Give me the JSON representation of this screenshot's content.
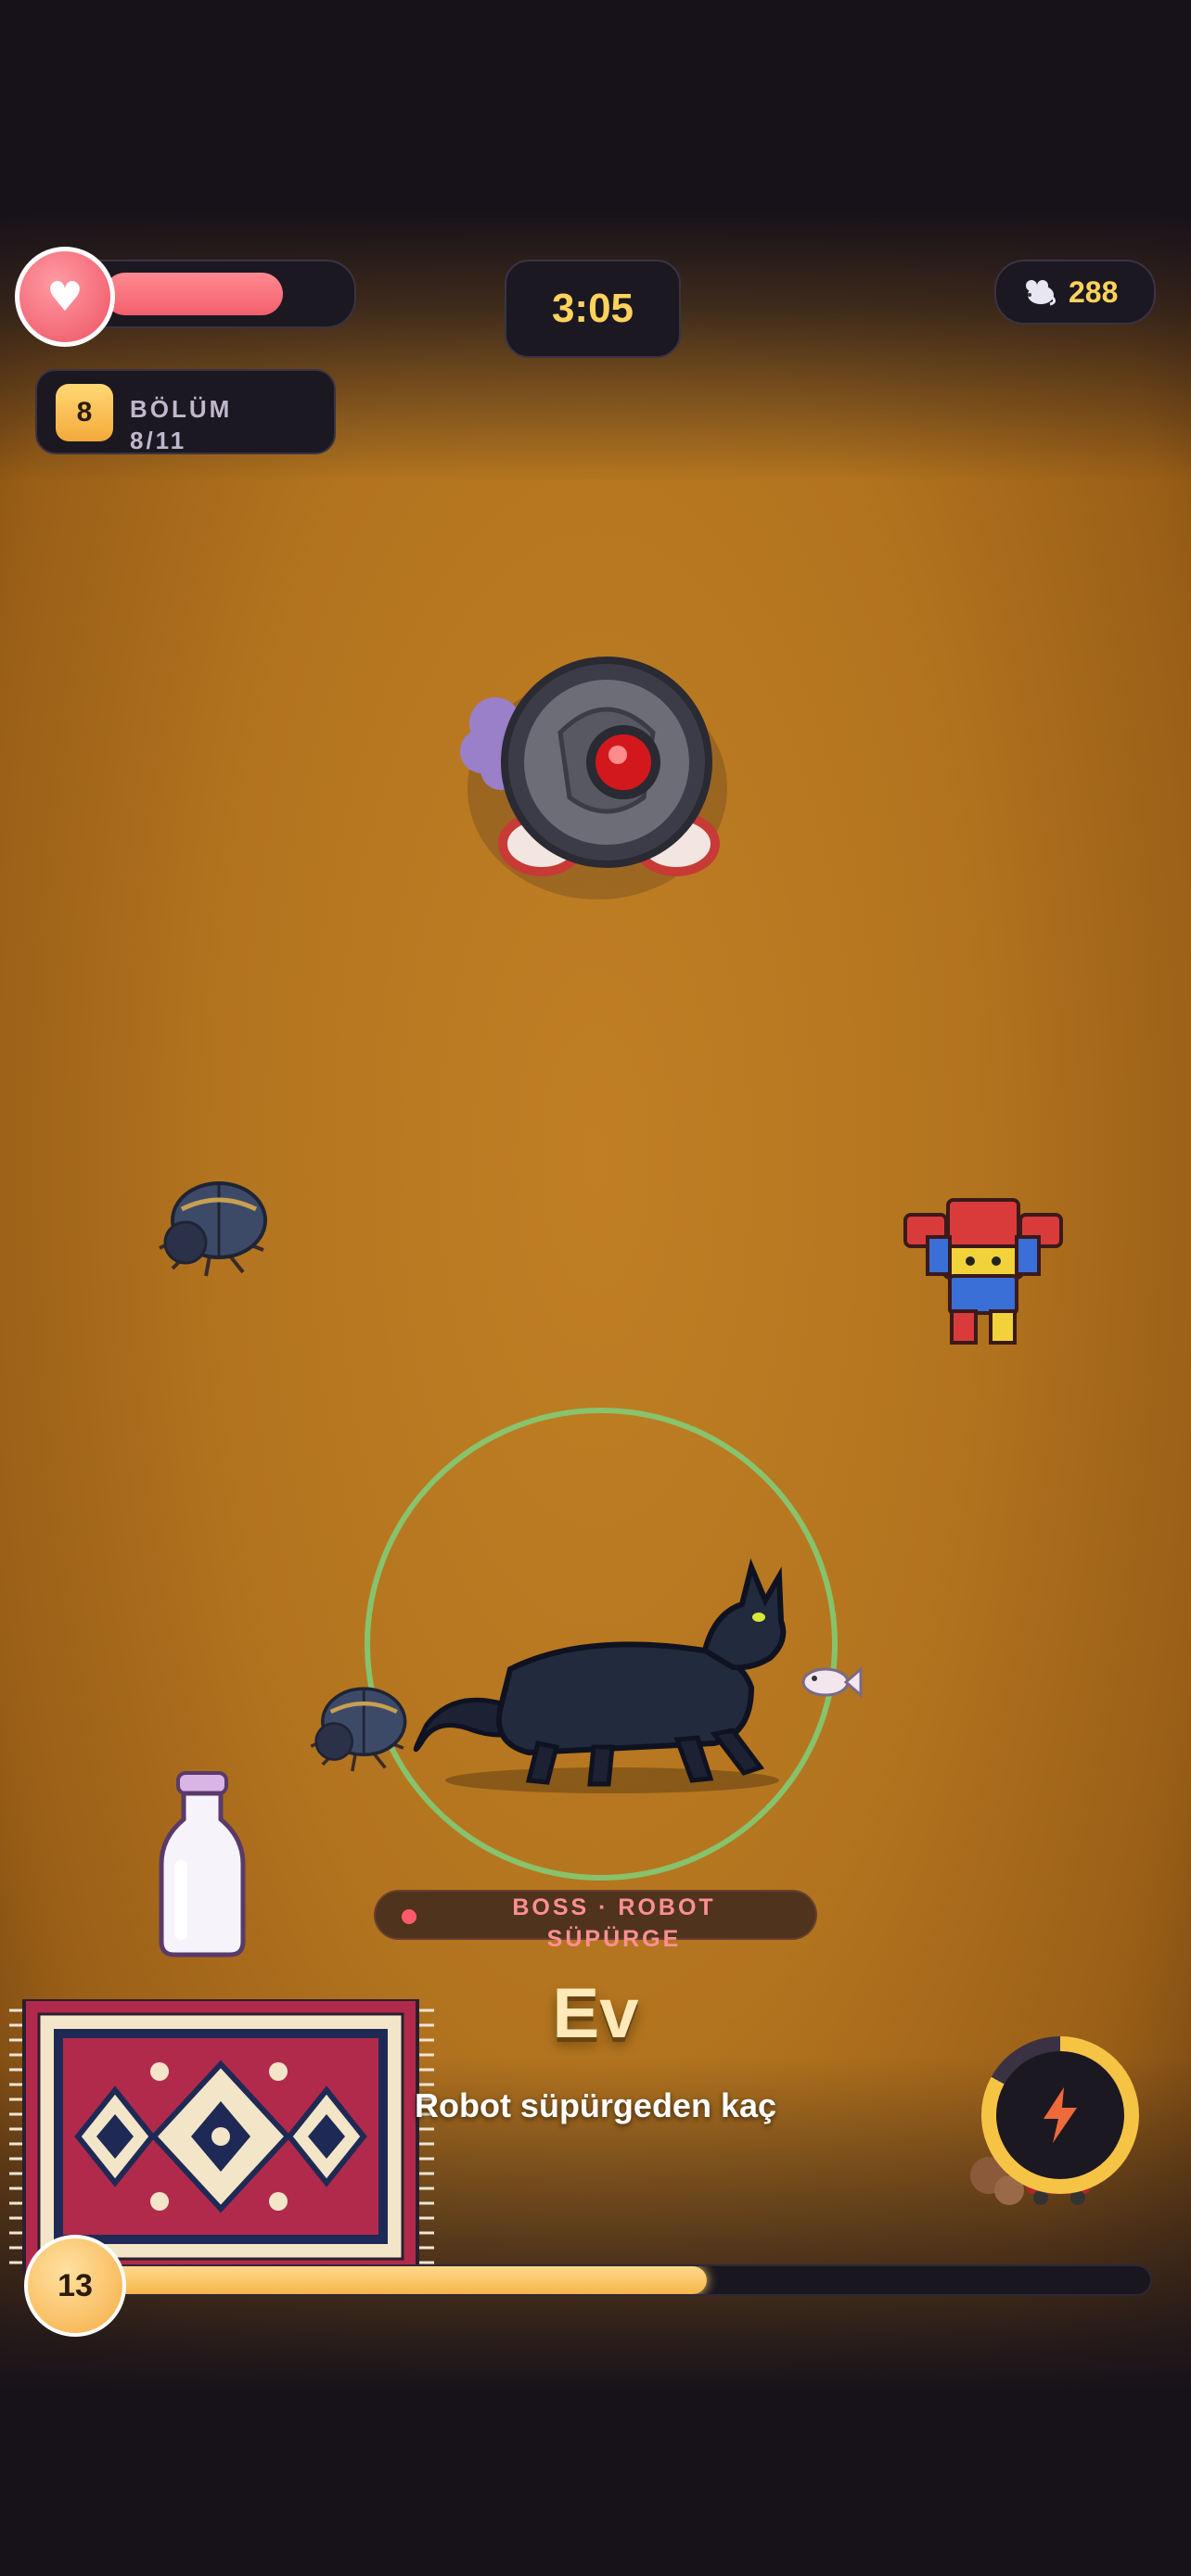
{
  "hud": {
    "health": {
      "icon": "heart-icon",
      "glyph": "♥",
      "fraction": 0.76
    },
    "timer": "3:05",
    "score": {
      "icon": "mouse-icon",
      "value": "288"
    },
    "level": {
      "number": "8",
      "label": "BÖLÜM",
      "progress": "8/11"
    }
  },
  "boss": {
    "label": "BOSS · ROBOT SÜPÜRGE",
    "name": "robot-vacuum"
  },
  "zone": {
    "title": "Ev",
    "subtitle": "Robot süpürgeden kaç"
  },
  "xp": {
    "level": "13",
    "fraction": 0.58
  },
  "ability": {
    "icon": "lightning-icon",
    "cooldown_fraction": 0.83
  },
  "colors": {
    "accent": "#ffd35b",
    "health": "#f25f6c",
    "aura": "#7fd07a",
    "background": "#b3741f"
  }
}
